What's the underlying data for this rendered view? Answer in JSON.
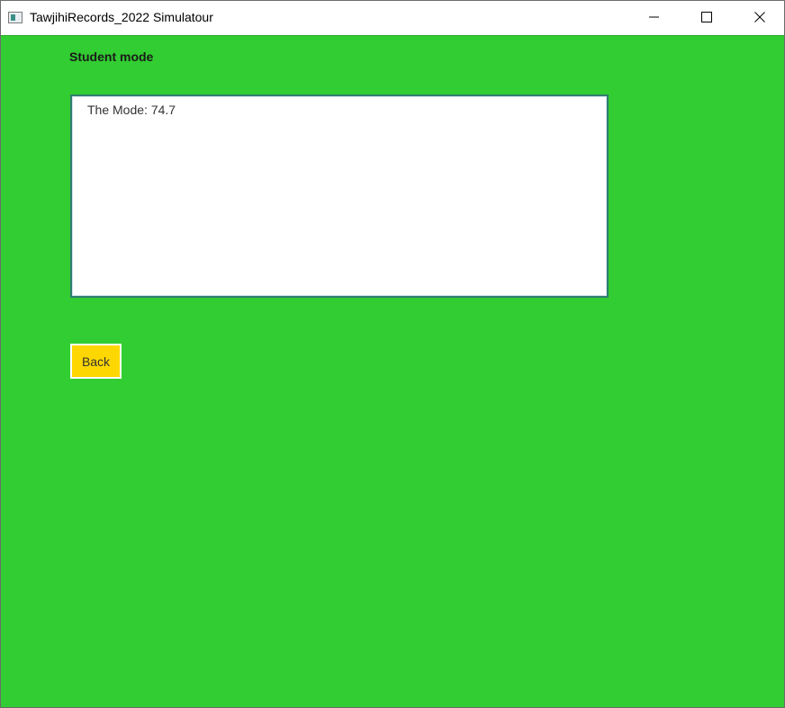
{
  "window": {
    "title": "TawjihiRecords_2022 Simulatour",
    "icon": "app-window-icon",
    "controls": {
      "minimize_icon": "minimize-icon",
      "maximize_icon": "maximize-icon",
      "close_icon": "close-icon"
    }
  },
  "main": {
    "heading": "Student mode",
    "output_text": "The Mode: 74.7",
    "back_label": "Back"
  },
  "colors": {
    "background": "#32CD32",
    "button": "#FFD700",
    "textbox_border": "#2f7d6d"
  }
}
